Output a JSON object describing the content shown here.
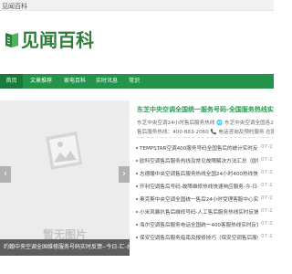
{
  "site": {
    "top_title": "见闻百科",
    "logo_text": "见闻百科",
    "brand_color": "#24944a",
    "accent_color": "#2a9a52"
  },
  "nav": [
    {
      "label": "首页",
      "active": true
    },
    {
      "label": "文章推荐",
      "active": false
    },
    {
      "label": "家电百科",
      "active": false
    },
    {
      "label": "实时讯息",
      "active": false
    },
    {
      "label": "常识",
      "active": false
    }
  ],
  "slider": {
    "placeholder_text": "暂无图片",
    "caption": "约翰中央空调全国维修服务号码实时反馈--今日-汇-总-(仍",
    "prev_arrow": "‹",
    "next_arrow": "›"
  },
  "featured": {
    "headline": "东芝中央空调全国统一服务号码-全国服务热线实时",
    "desc_1": "东芝中央空调24小时售后服务热线 🌐 东芝中央空调全国各24小时",
    "desc_2": "售后服务热线：400-883-2060 📞 电话咨询及预约服务 在服务"
  },
  "news": [
    {
      "title": "TEMPSTAR空调400服务号码全国售后的统计实时反馈--今...",
      "date": "07-2"
    },
    {
      "title": "欧科空调售后服务热线及常见故障解决方法汇总（欧科...",
      "date": "07-2"
    },
    {
      "title": "志德暖中央空调售后服务热线全国24小时400热线快速...",
      "date": "07-2"
    },
    {
      "title": "开利空调售后号码-故障维修热线快速响应服务-今-日-汇...",
      "date": "07-2"
    },
    {
      "title": "奥克斯中央空调全国统一售后24小时受理客服中心实时反馈--今...",
      "date": "07-2"
    },
    {
      "title": "小米风暴扒售后维修号码-人工售后服务热线实时反馈--今...",
      "date": "07-2"
    },
    {
      "title": "海尔空调售后服务电话全国统一400客服热线实时反馈--今...",
      "date": "07-2"
    },
    {
      "title": "保安空调售后服务指南及报修技巧（保安空调售后服务...",
      "date": "07-2"
    }
  ]
}
